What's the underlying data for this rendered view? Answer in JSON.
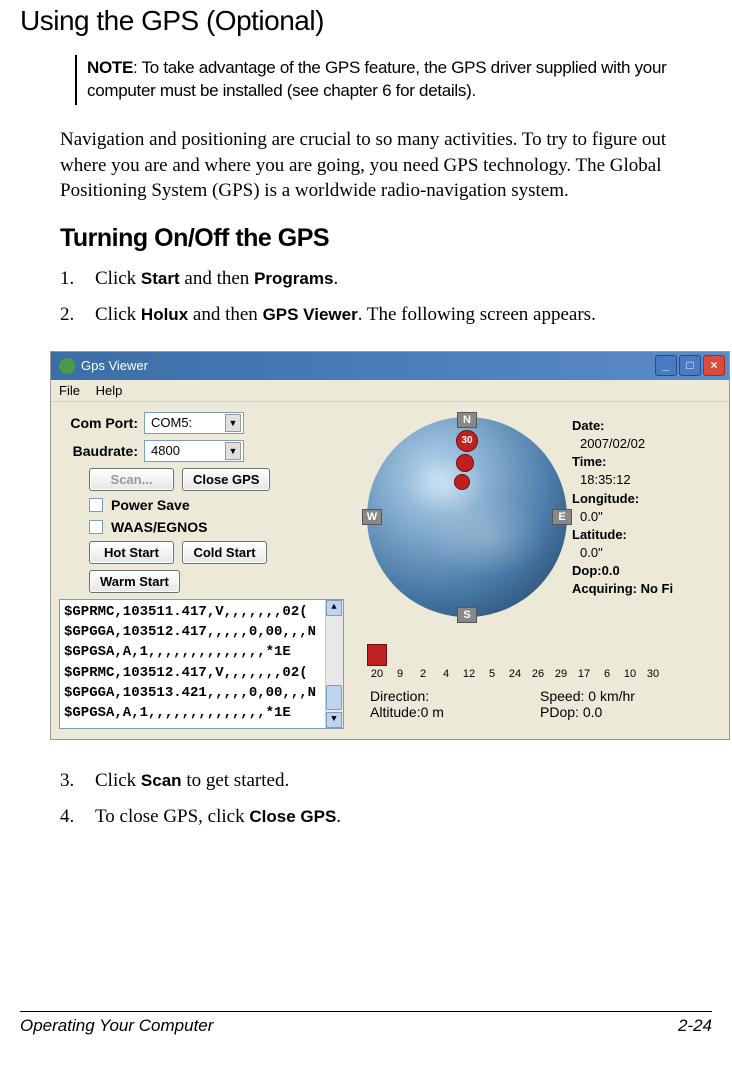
{
  "title": "Using the GPS (Optional)",
  "note": {
    "label": "NOTE",
    "text": ": To take advantage of the GPS feature, the GPS driver supplied with your computer must be installed (see chapter 6 for details)."
  },
  "intro": "Navigation and positioning are crucial to so many activities. To try to figure out where you are and where you are going, you need GPS technology. The Global Positioning System (GPS) is a worldwide radio-navigation system.",
  "subtitle": "Turning On/Off the GPS",
  "steps": [
    {
      "num": "1.",
      "prefix": "Click ",
      "b1": "Start",
      "mid": " and then ",
      "b2": "Programs",
      "suffix": "."
    },
    {
      "num": "2.",
      "prefix": "Click ",
      "b1": "Holux",
      "mid": " and then ",
      "b2": "GPS Viewer",
      "suffix": ". The following screen appears."
    },
    {
      "num": "3.",
      "prefix": "Click ",
      "b1": "Scan",
      "mid": " to get started.",
      "b2": "",
      "suffix": ""
    },
    {
      "num": "4.",
      "prefix": "To close GPS, click ",
      "b1": "Close GPS",
      "mid": ".",
      "b2": "",
      "suffix": ""
    }
  ],
  "window": {
    "title": "Gps Viewer",
    "menu": {
      "file": "File",
      "help": "Help"
    },
    "comport_label": "Com Port:",
    "comport_value": "COM5:",
    "baudrate_label": "Baudrate:",
    "baudrate_value": "4800",
    "scan_btn": "Scan...",
    "close_gps_btn": "Close GPS",
    "power_save": "Power Save",
    "waas": "WAAS/EGNOS",
    "hot_start": "Hot Start",
    "cold_start": "Cold Start",
    "warm_start": "Warm Start",
    "nmea": [
      "$GPRMC,103511.417,V,,,,,,,02(",
      "$GPGGA,103512.417,,,,,0,00,,,N",
      "$GPGSA,A,1,,,,,,,,,,,,,,*1E",
      "$GPRMC,103512.417,V,,,,,,,02(",
      "$GPGGA,103513.421,,,,,0,00,,,N",
      "$GPGSA,A,1,,,,,,,,,,,,,,*1E"
    ],
    "compass": {
      "n": "N",
      "s": "S",
      "e": "E",
      "w": "W"
    },
    "sat_visible": {
      "id": "30"
    },
    "info": {
      "date_label": "Date:",
      "date_value": "2007/02/02",
      "time_label": "Time:",
      "time_value": "18:35:12",
      "lon_label": "Longitude:",
      "lon_value": "0.0\"",
      "lat_label": "Latitude:",
      "lat_value": "0.0\"",
      "dop_label": "Dop:",
      "dop_value": "0.0",
      "acq": "Acquiring: No Fi"
    },
    "sat_ids": [
      "20",
      "9",
      "2",
      "4",
      "12",
      "5",
      "24",
      "26",
      "29",
      "17",
      "6",
      "10",
      "30"
    ],
    "bottom": {
      "direction_label": "Direction:",
      "altitude_label": "Altitude:",
      "altitude_value": "0 m",
      "speed_label": "Speed:",
      "speed_value": "0 km/hr",
      "pdop_label": "PDop:",
      "pdop_value": "0.0"
    }
  },
  "footer": {
    "left": "Operating Your Computer",
    "right": "2-24"
  }
}
